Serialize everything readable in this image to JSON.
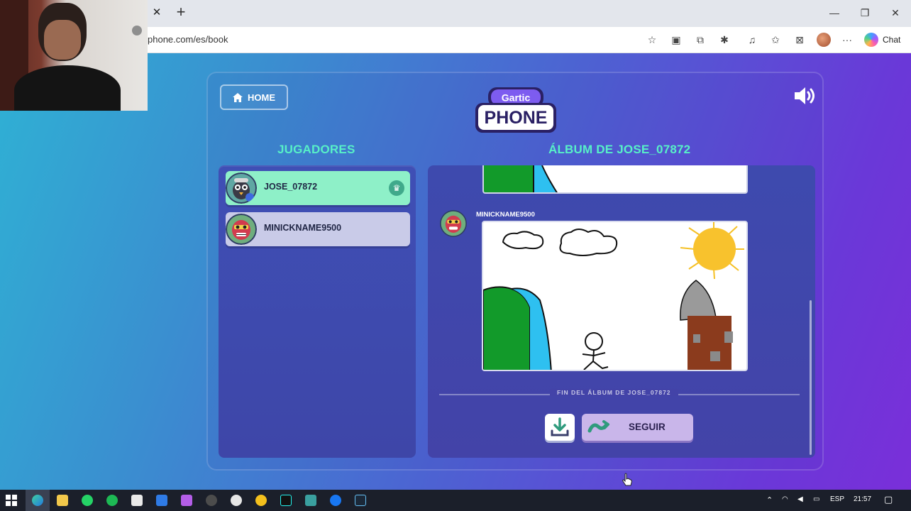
{
  "browser": {
    "url": "phone.com/es/book",
    "close_tab": "✕",
    "new_tab": "+",
    "chat_label": "Chat",
    "window": {
      "minimize": "—",
      "restore": "❐",
      "close": "✕"
    }
  },
  "game": {
    "home_label": "HOME",
    "logo_top": "Gartic",
    "logo_bottom": "PHONE",
    "players_title": "JUGADORES",
    "album_title": "ÁLBUM DE JOSE_07872",
    "players": [
      {
        "name": "JOSE_07872",
        "host": true,
        "bg": "#8ef0c8"
      },
      {
        "name": "MINICKNAME9500",
        "host": false,
        "bg": "#c9cbe8"
      }
    ],
    "entry_author": "MINICKNAME9500",
    "end_label": "FIN DEL ÁLBUM DE JOSE_07872",
    "next_label": "SEGUIR"
  },
  "taskbar": {
    "language": "ESP",
    "time": "21:57"
  },
  "colors": {
    "accent_green": "#57f0c8",
    "panel": "#3f4fb5",
    "button_purple": "#c9b6ea"
  }
}
